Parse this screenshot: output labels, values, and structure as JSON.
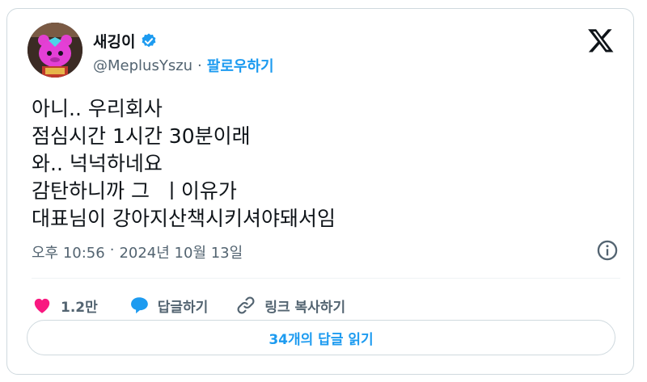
{
  "author": {
    "display_name": "새깅이",
    "handle": "@MeplusYszu",
    "separator": "·",
    "follow_label": "팔로우하기",
    "verified_color": "#1d9bf0"
  },
  "tweet": {
    "lines": [
      "아니.. 우리회사",
      "점심시간 1시간 30분이래",
      "와.. 넉넉하네요",
      "감탄하니까 그  ㅣ이유가",
      "대표님이 강아지산책시키셔야돼서임"
    ],
    "time": "오후 10:56",
    "separator": "·",
    "date": "2024년 10월 13일"
  },
  "actions": {
    "like_count": "1.2만",
    "reply_label": "답글하기",
    "copy_link_label": "링크 복사하기",
    "like_color": "#f91880",
    "reply_color": "#1d9bf0"
  },
  "read_replies_label": "34개의 답글 읽기",
  "icons": {
    "brand": "x-logo-icon",
    "info": "info-icon",
    "like": "heart-icon",
    "reply": "reply-bubble-icon",
    "link": "link-icon",
    "verified": "verified-badge-icon"
  }
}
